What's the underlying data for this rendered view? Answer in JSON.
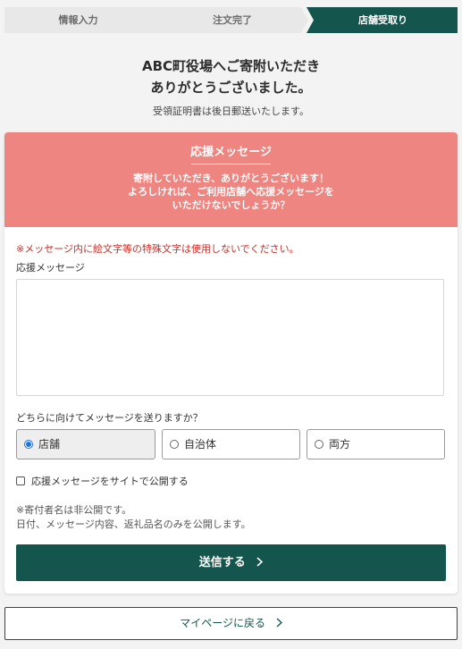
{
  "steps": [
    {
      "label": "情報入力",
      "state": "done"
    },
    {
      "label": "注文完了",
      "state": "done"
    },
    {
      "label": "店舗受取り",
      "state": "current"
    }
  ],
  "heading": {
    "line1": "ABC町役場へご寄附いただき",
    "line2": "ありがとうございました。",
    "sub": "受領証明書は後日郵送いたします。"
  },
  "banner": {
    "title": "応援メッセージ",
    "line1": "寄附していただき、ありがとうございます！",
    "line2": "よろしければ、ご利用店舗へ応援メッセージを",
    "line3": "いただけないでしょうか？"
  },
  "form": {
    "warning": "※メッセージ内に絵文字等の特殊文字は使用しないでください。",
    "message_label": "応援メッセージ",
    "message_value": "",
    "recipient_question": "どちらに向けてメッセージを送りますか？",
    "recipient_options": [
      {
        "label": "店舗",
        "selected": true
      },
      {
        "label": "自治体",
        "selected": false
      },
      {
        "label": "両方",
        "selected": false
      }
    ],
    "publish_label": "応援メッセージをサイトで公開する",
    "note_line1": "※寄付者名は非公開です。",
    "note_line2": "日付、メッセージ内容、返礼品名のみを公開します。",
    "submit_label": "送信する"
  },
  "back_label": "マイページに戻る",
  "colors": {
    "primary": "#14564d",
    "banner": "#ee8580",
    "warning": "#c8302a",
    "radio_selected": "#1a73e8"
  },
  "icons": {
    "submit": "chevron-right-icon",
    "back": "chevron-right-icon"
  }
}
